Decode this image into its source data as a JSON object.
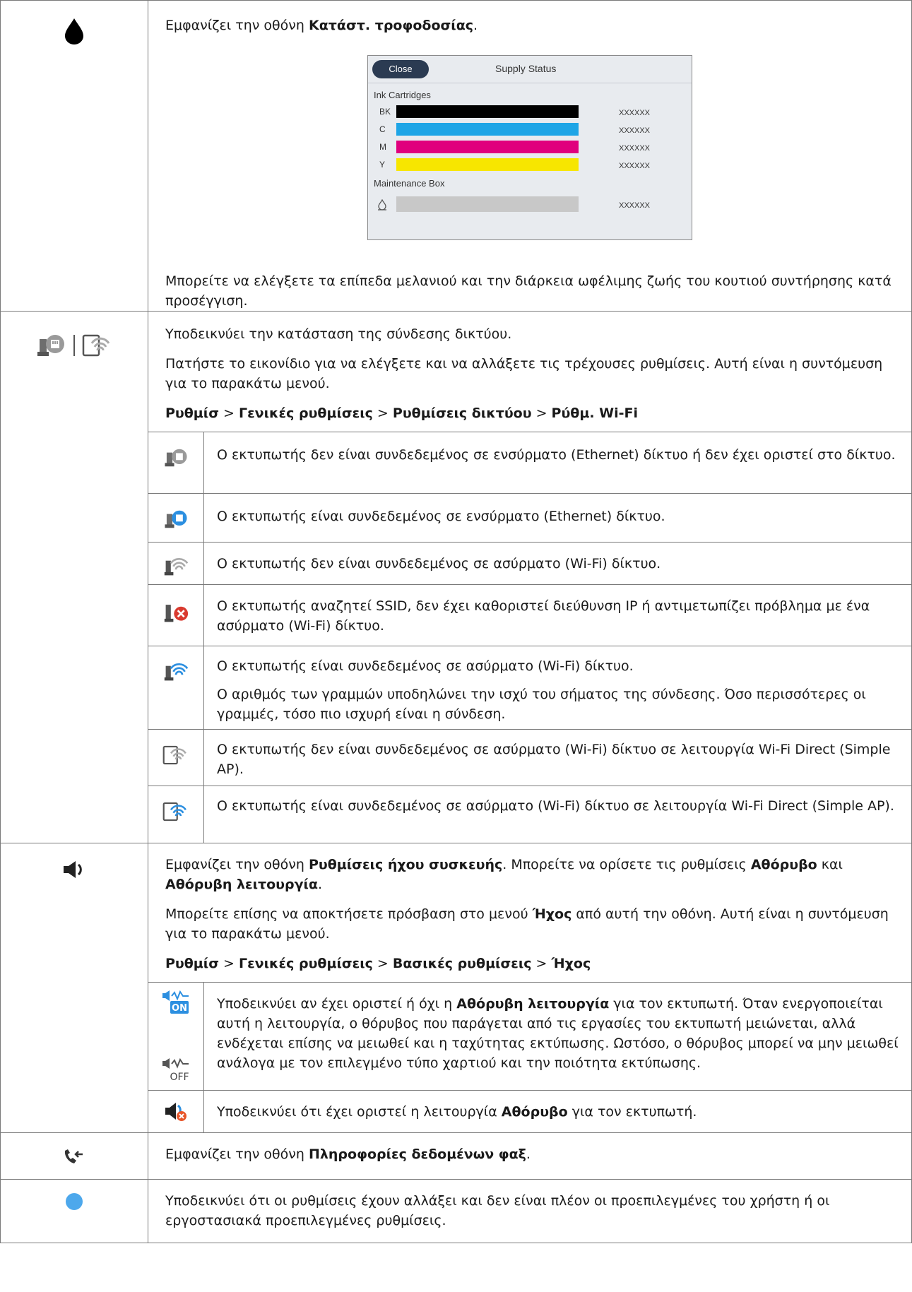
{
  "rows": [
    {
      "icon": "ink-drop-icon",
      "p1": {
        "pre": "Εμφανίζει την οθόνη ",
        "b": "Κατάστ. τροφοδοσίας",
        "post": "."
      },
      "supply": {
        "close": "Close",
        "title": "Supply Status",
        "ink_label": "Ink Cartridges",
        "inks": [
          {
            "label": "BK",
            "color": "#000000",
            "value": "XXXXXX"
          },
          {
            "label": "C",
            "color": "#1ea5e6",
            "value": "XXXXXX"
          },
          {
            "label": "M",
            "color": "#e0007d",
            "value": "XXXXXX"
          },
          {
            "label": "Y",
            "color": "#f7e600",
            "value": "XXXXXX"
          }
        ],
        "maint_label": "Maintenance Box",
        "maint": {
          "color": "#c8c8c8",
          "value": "XXXXXX"
        }
      },
      "p2": "Μπορείτε να ελέγξετε τα επίπεδα μελανιού και την διάρκεια ωφέλιμης ζωής του κουτιού συντήρησης κατά προσέγγιση."
    },
    {
      "p1": "Υποδεικνύει την κατάσταση της σύνδεσης δικτύου.",
      "p2": "Πατήστε το εικονίδιο για να ελέγξετε και να αλλάξετε τις τρέχουσες ρυθμίσεις. Αυτή είναι η συντόμευση για το παρακάτω μενού.",
      "path": [
        "Ρυθμίσ",
        " > ",
        "Γενικές ρυθμίσεις",
        " > ",
        "Ρυθμίσεις δικτύου",
        " > ",
        "Ρύθμ. Wi-Fi"
      ],
      "sub": [
        {
          "icon": "ethernet-disconnected-icon",
          "text": "Ο εκτυπωτής δεν είναι συνδεδεμένος σε ενσύρματο (Ethernet) δίκτυο ή δεν έχει οριστεί στο δίκτυο."
        },
        {
          "icon": "ethernet-connected-icon",
          "text": "Ο εκτυπωτής είναι συνδεδεμένος σε ενσύρματο (Ethernet) δίκτυο."
        },
        {
          "icon": "wifi-disconnected-icon",
          "text": "Ο εκτυπωτής δεν είναι συνδεδεμένος σε ασύρματο (Wi-Fi) δίκτυο."
        },
        {
          "icon": "wifi-error-icon",
          "text": "Ο εκτυπωτής αναζητεί SSID, δεν έχει καθοριστεί διεύθυνση IP ή αντιμετωπίζει πρόβλημα με ένα ασύρματο (Wi-Fi) δίκτυο."
        },
        {
          "icon": "wifi-connected-icon",
          "text": "Ο εκτυπωτής είναι συνδεδεμένος σε ασύρματο (Wi-Fi) δίκτυο.",
          "text2": "Ο αριθμός των γραμμών υποδηλώνει την ισχύ του σήματος της σύνδεσης. Όσο περισσότερες οι γραμμές, τόσο πιο ισχυρή είναι η σύνδεση."
        },
        {
          "icon": "wifi-direct-disconnected-icon",
          "text": "Ο εκτυπωτής δεν είναι συνδεδεμένος σε ασύρματο (Wi-Fi) δίκτυο σε λειτουργία Wi-Fi Direct (Simple AP)."
        },
        {
          "icon": "wifi-direct-connected-icon",
          "text": "Ο εκτυπωτής είναι συνδεδεμένος σε ασύρματο (Wi-Fi) δίκτυο σε λειτουργία Wi-Fi Direct (Simple AP)."
        }
      ]
    },
    {
      "p1": {
        "a": "Εμφανίζει την οθόνη ",
        "b1": "Ρυθμίσεις ήχου συσκευής",
        "c": ". Μπορείτε να ορίσετε τις ρυθμίσεις ",
        "b2": "Αθόρυβο",
        "d": " και ",
        "b3": "Αθόρυβη λειτουργία",
        "e": "."
      },
      "p2": {
        "a": "Μπορείτε επίσης να αποκτήσετε πρόσβαση στο μενού ",
        "b": "Ήχος",
        "c": " από αυτή την οθόνη. Αυτή είναι η συντόμευση για το παρακάτω μενού."
      },
      "path": [
        "Ρυθμίσ",
        " > ",
        "Γενικές ρυθμίσεις",
        " > ",
        "Βασικές ρυθμίσεις",
        " > ",
        "Ήχος"
      ],
      "on_label": "ON",
      "off_label": "OFF",
      "sub1": {
        "a": "Υποδεικνύει αν έχει οριστεί ή όχι η ",
        "b": "Αθόρυβη λειτουργία",
        "c": " για τον εκτυπωτή. Όταν ενεργοποιείται αυτή η λειτουργία, ο θόρυβος που παράγεται από τις εργασίες του εκτυπωτή μειώνεται, αλλά ενδέχεται επίσης να μειωθεί και η ταχύτητας εκτύπωσης. Ωστόσο, ο θόρυβος μπορεί να μην μειωθεί ανάλογα με τον επιλεγμένο τύπο χαρτιού και την ποιότητα εκτύπωσης."
      },
      "sub2": {
        "a": "Υποδεικνύει ότι έχει οριστεί η λειτουργία ",
        "b": "Αθόρυβο",
        "c": " για τον εκτυπωτή."
      }
    },
    {
      "p1": {
        "a": "Εμφανίζει την οθόνη ",
        "b": "Πληροφορίες δεδομένων φαξ",
        "c": "."
      }
    },
    {
      "p1": "Υποδεικνύει ότι οι ρυθμίσεις έχουν αλλάξει και δεν είναι πλέον οι προεπιλεγμένες του χρήστη ή οι εργοστασιακά προεπιλεγμένες ρυθμίσεις."
    }
  ]
}
